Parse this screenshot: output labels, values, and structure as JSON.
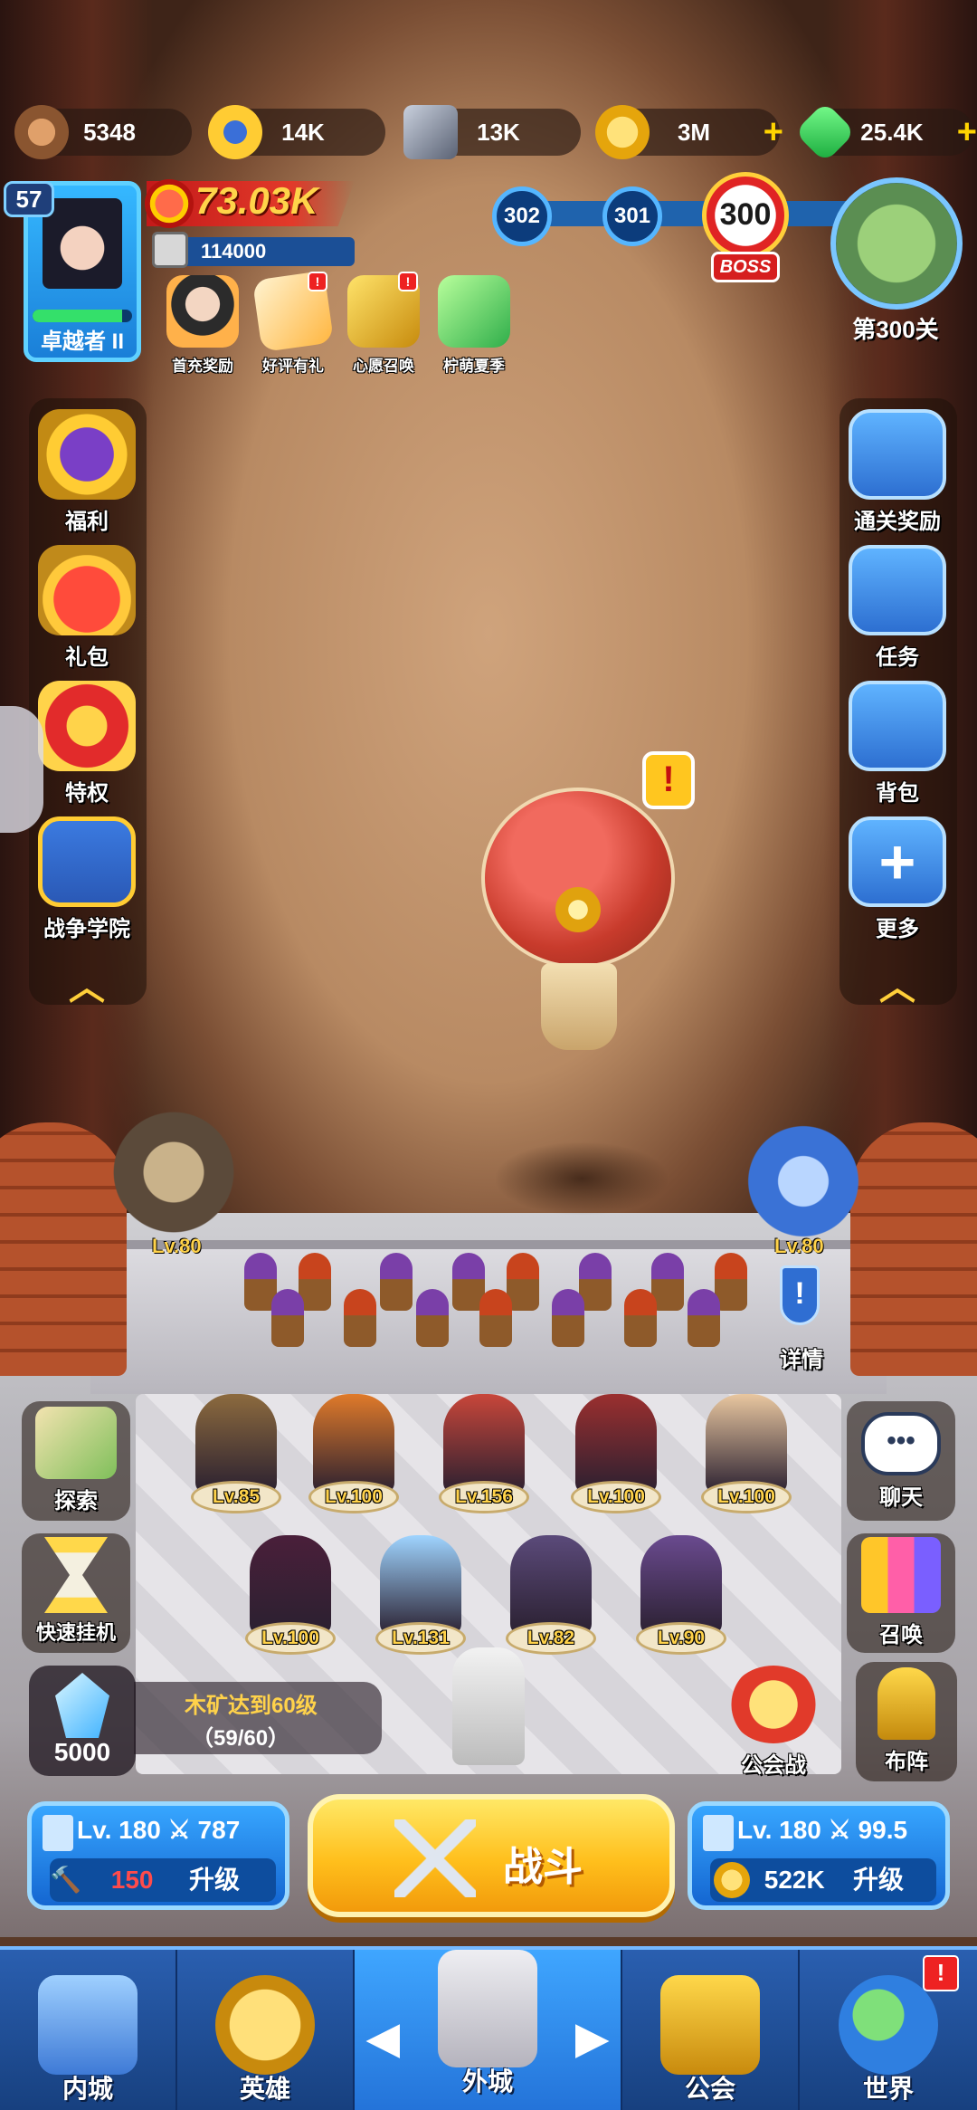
{
  "resources": [
    {
      "name": "wood",
      "value": "5348",
      "color": "#b8784a"
    },
    {
      "name": "medal",
      "value": "14K",
      "color": "#ffcc33"
    },
    {
      "name": "iron",
      "value": "13K",
      "color": "#8a93a8"
    },
    {
      "name": "gold",
      "value": "3M",
      "color": "#ffc629"
    },
    {
      "name": "gem",
      "value": "25.4K",
      "color": "#35d35a"
    }
  ],
  "player": {
    "level": "57",
    "rank": "卓越者 II",
    "power": "73.03K",
    "castle_power": "114000",
    "xp_fraction": 0.9
  },
  "events": [
    {
      "label": "首充奖励",
      "icon": "first-recharge-icon",
      "badge": ""
    },
    {
      "label": "好评有礼",
      "icon": "review-gift-icon",
      "badge": "!"
    },
    {
      "label": "心愿召唤",
      "icon": "wish-summon-icon",
      "badge": "!"
    },
    {
      "label": "柠萌夏季",
      "icon": "lemon-summer-icon",
      "badge": ""
    }
  ],
  "stage": {
    "nodes": [
      "302",
      "301"
    ],
    "current": "300",
    "boss_tag": "BOSS",
    "label": "第300关"
  },
  "left_menu": [
    {
      "label": "福利",
      "icon": "welfare-icon"
    },
    {
      "label": "礼包",
      "icon": "gift-pack-icon"
    },
    {
      "label": "特权",
      "icon": "privilege-icon"
    },
    {
      "label": "战争学院",
      "icon": "war-academy-icon"
    }
  ],
  "right_menu": [
    {
      "label": "通关奖励",
      "icon": "clear-reward-icon"
    },
    {
      "label": "任务",
      "icon": "task-icon"
    },
    {
      "label": "背包",
      "icon": "backpack-icon"
    },
    {
      "label": "更多",
      "icon": "more-icon"
    }
  ],
  "alert": "!",
  "towers": {
    "left_level": "Lv.80",
    "right_level": "Lv.80",
    "detail_label": "详情"
  },
  "heroes_row1": [
    "Lv.85",
    "Lv.100",
    "Lv.156",
    "Lv.100",
    "Lv.100"
  ],
  "heroes_row2": [
    "Lv.100",
    "Lv.131",
    "Lv.82",
    "Lv.90"
  ],
  "hero_colors_row1": [
    "#8c6a3e",
    "#e07a2a",
    "#c8463a",
    "#9b2f2f",
    "#e9c7a0"
  ],
  "hero_colors_row2": [
    "#4a1f3a",
    "#9fd4ff",
    "#5b4a7a",
    "#6a4a8f"
  ],
  "left_bottom": [
    {
      "label": "探索",
      "icon": "explore-map-icon"
    },
    {
      "label": "快速挂机",
      "icon": "hourglass-icon"
    }
  ],
  "right_bottom": [
    {
      "label": "聊天",
      "icon": "chat-icon"
    },
    {
      "label": "召唤",
      "icon": "summon-cards-icon"
    }
  ],
  "crystal": {
    "value": "5000",
    "quest": "木矿达到60级",
    "progress": "（59/60）"
  },
  "guild_war": "公会战",
  "formation": "布阵",
  "left_upgrade": {
    "level": "Lv. 180",
    "power": "787",
    "cost": "150",
    "action": "升级"
  },
  "battle": "战斗",
  "right_upgrade": {
    "level": "Lv. 180",
    "power": "99.5",
    "cost": "522K",
    "action": "升级"
  },
  "nav": [
    {
      "label": "内城",
      "icon": "inner-castle-icon"
    },
    {
      "label": "英雄",
      "icon": "hero-helmet-icon"
    },
    {
      "label": "外城",
      "icon": "outer-castle-icon"
    },
    {
      "label": "公会",
      "icon": "guild-handshake-icon"
    },
    {
      "label": "世界",
      "icon": "world-globe-icon",
      "badge": "!"
    }
  ]
}
